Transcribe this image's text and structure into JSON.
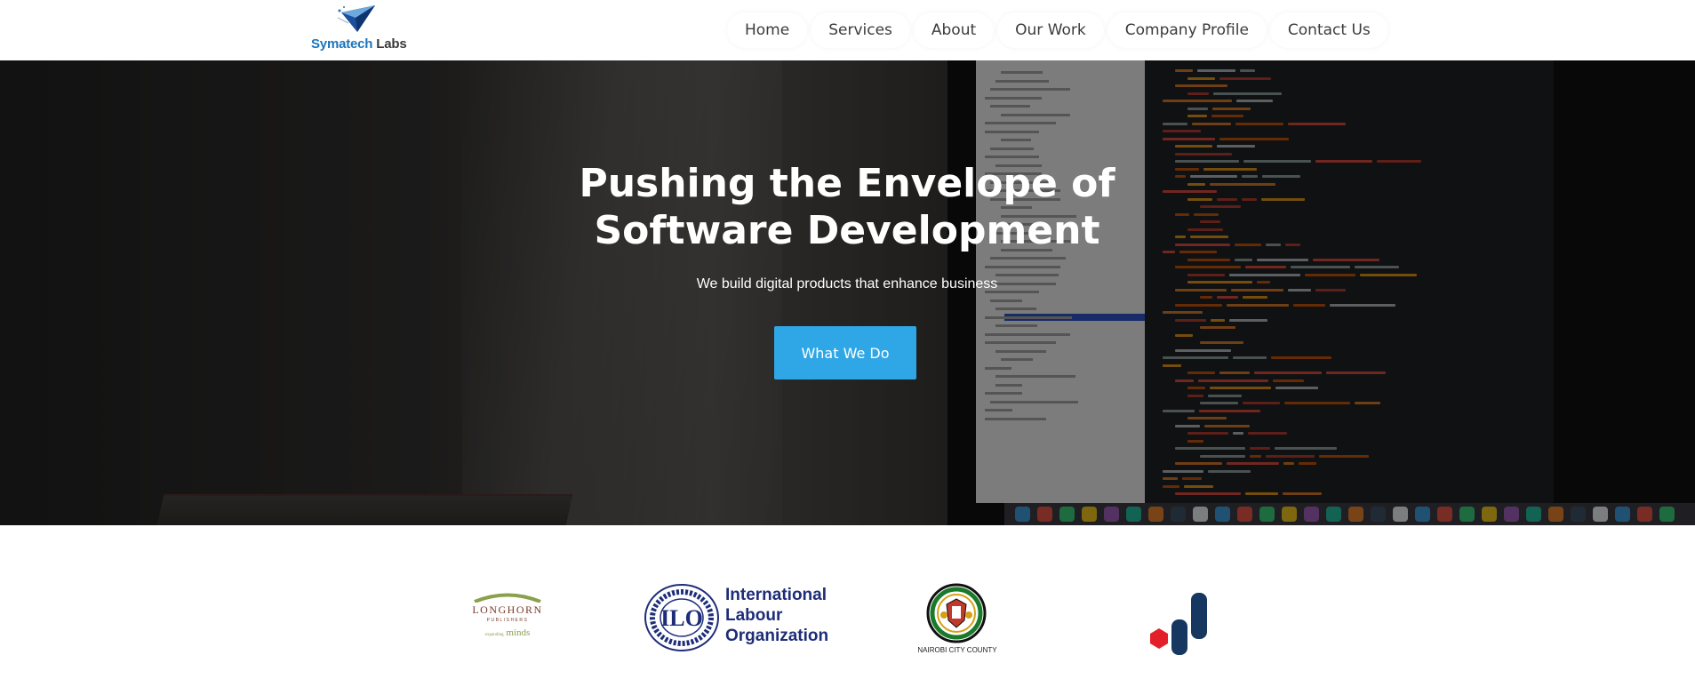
{
  "brand": {
    "name_part1": "Symatech",
    "name_part2": "Labs",
    "logo_icon": "paper-plane-logo-icon"
  },
  "nav": {
    "items": [
      {
        "label": "Home"
      },
      {
        "label": "Services"
      },
      {
        "label": "About"
      },
      {
        "label": "Our Work"
      },
      {
        "label": "Company Profile"
      },
      {
        "label": "Contact Us"
      }
    ]
  },
  "hero": {
    "title_line1": "Pushing the Envelope of",
    "title_line2": "Software Development",
    "subtitle": "We build digital products that enhance business",
    "cta_label": "What We Do",
    "background": "code-editor-photo"
  },
  "partners": {
    "longhorn": {
      "name": "LONGHORN",
      "sub": "PUBLISHERS",
      "tag_small": "expanding",
      "tag": "minds"
    },
    "ilo": {
      "line1": "International",
      "line2": "Labour",
      "line3": "Organization",
      "emblem_text": "ILO"
    },
    "nairobi": {
      "name": "NAIROBI CITY COUNTY"
    },
    "bars_logo": {
      "icon": "bar-chart-logo-icon"
    }
  },
  "colors": {
    "accent": "#2fa7e6",
    "brand_blue": "#1c75bc",
    "ilo_blue": "#1e2d78",
    "nav_text": "#3c3c3c"
  }
}
